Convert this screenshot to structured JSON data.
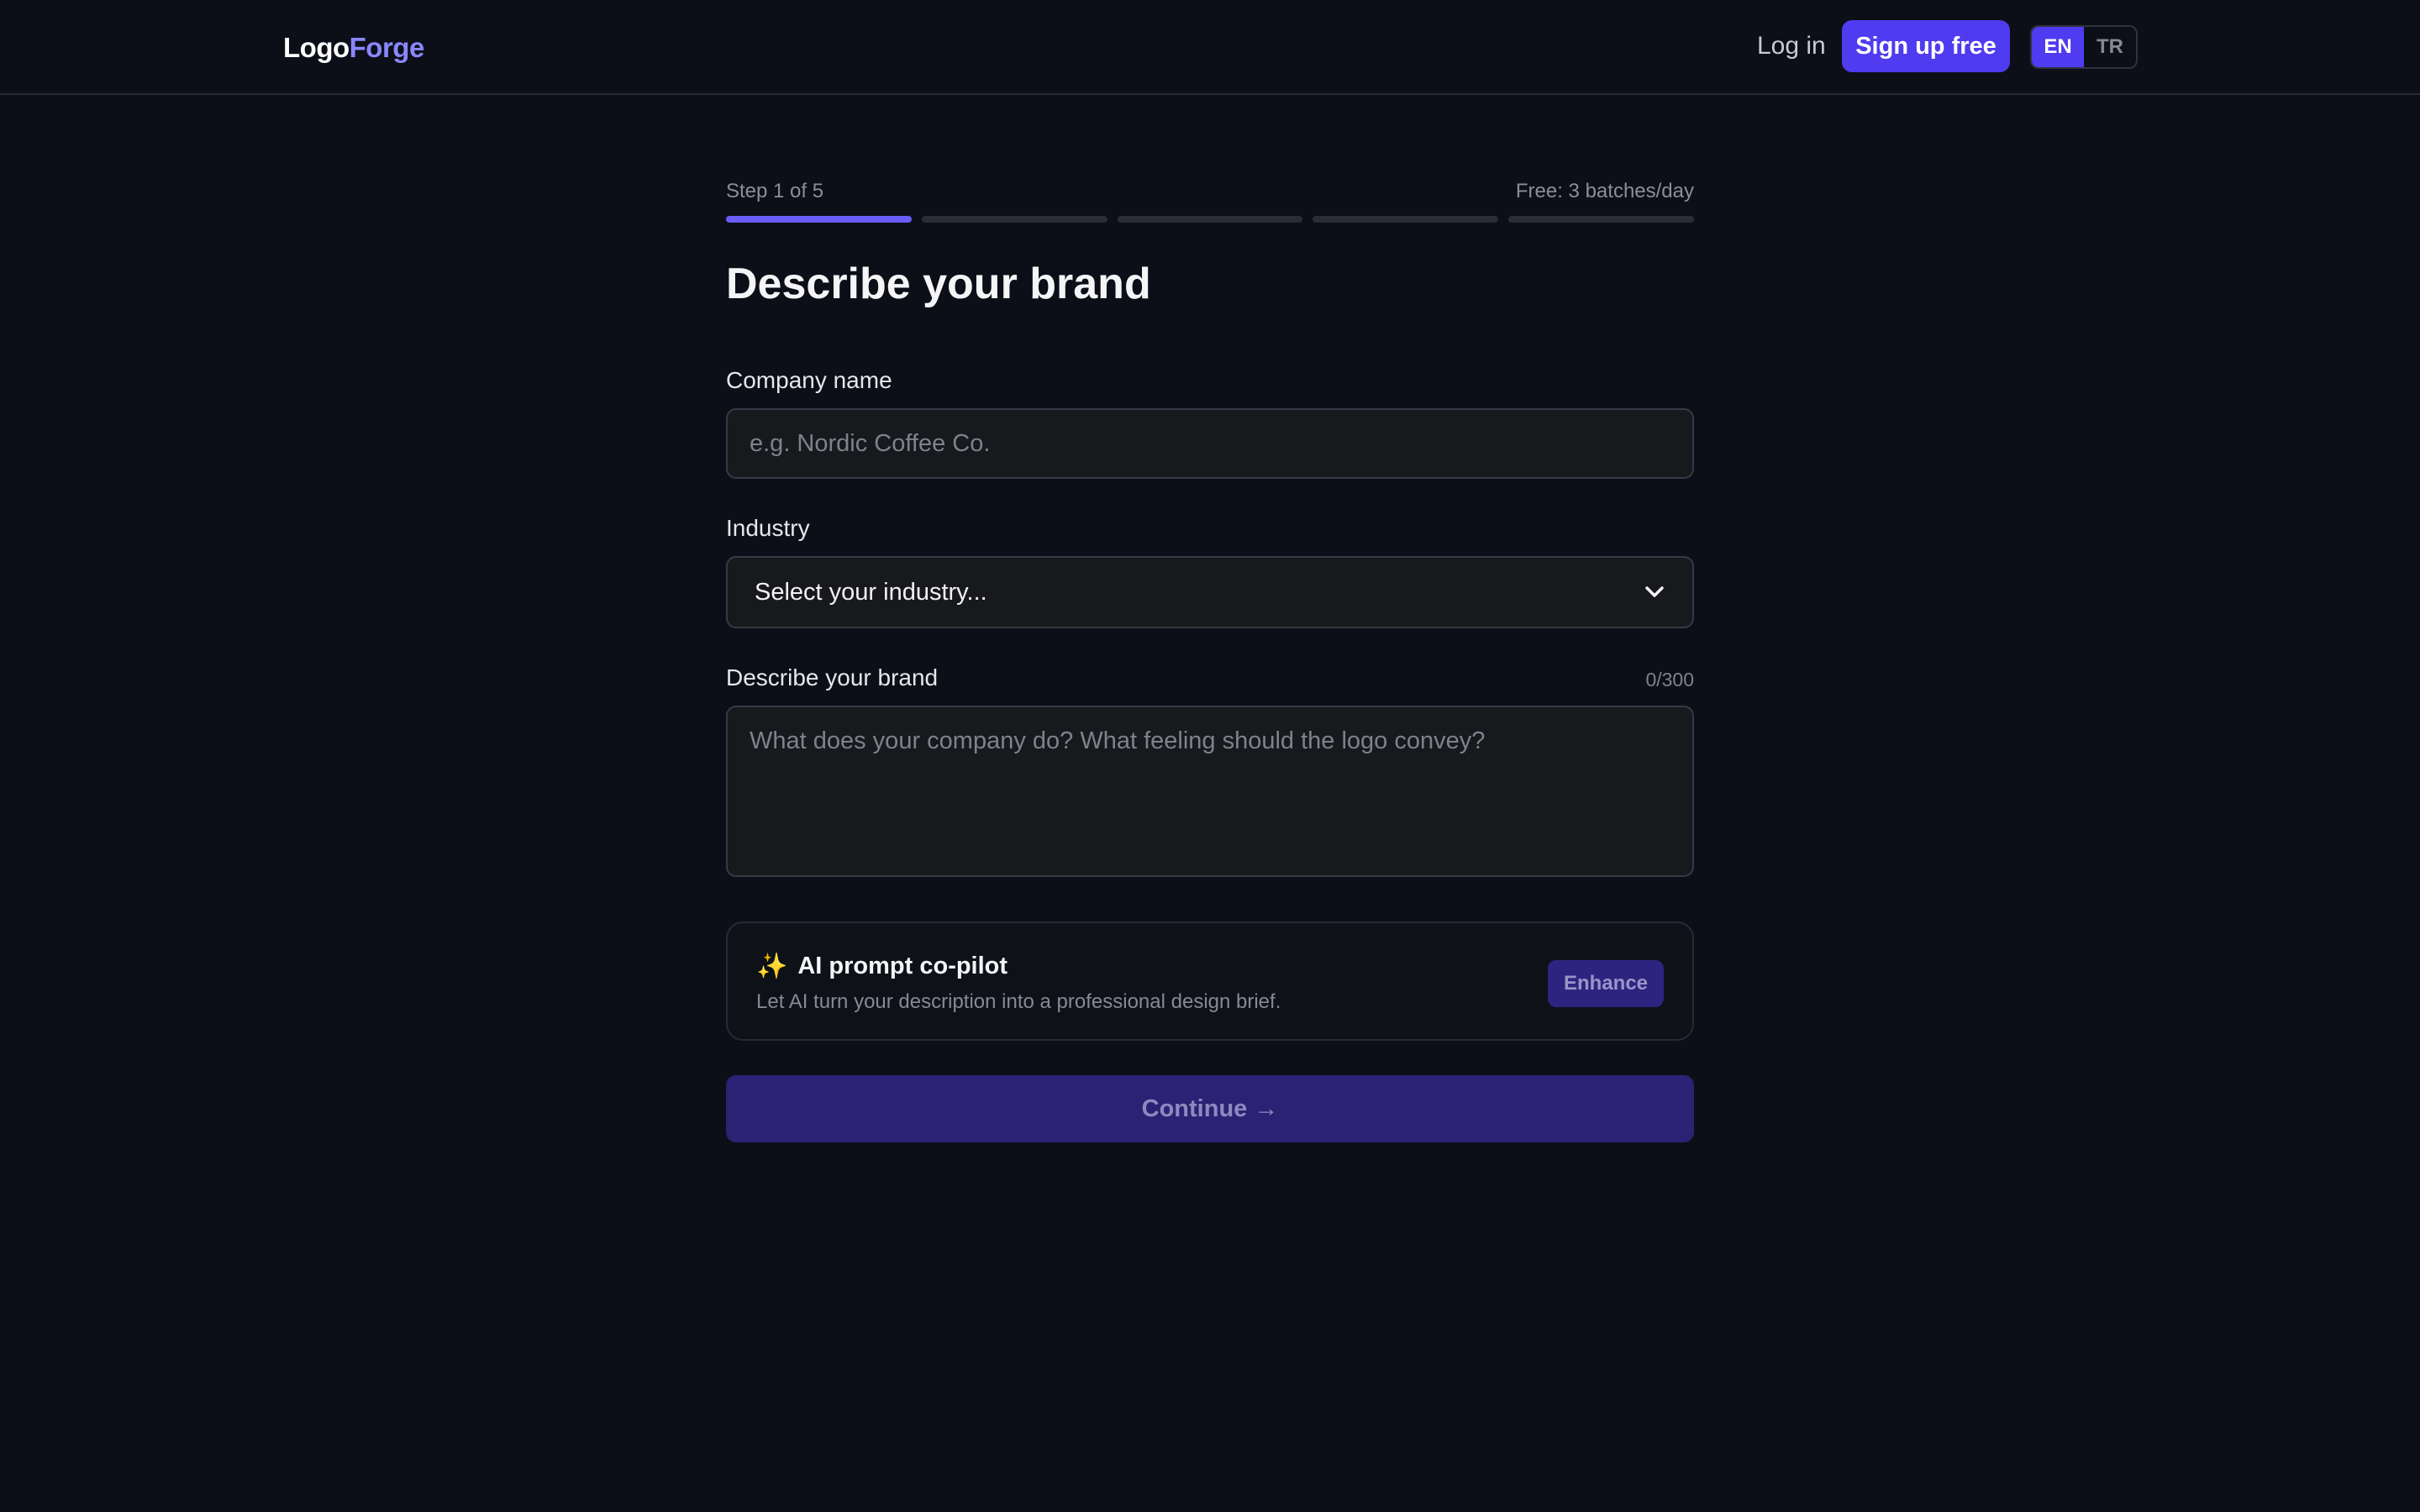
{
  "header": {
    "logo_part1": "Logo",
    "logo_part2": "Forge",
    "login_label": "Log in",
    "signup_label": "Sign up free",
    "languages": [
      {
        "code": "EN",
        "active": true
      },
      {
        "code": "TR",
        "active": false
      }
    ]
  },
  "stepper": {
    "step_label": "Step 1 of 5",
    "free_label": "Free: 3 batches/day",
    "total_steps": 5,
    "current_step": 1
  },
  "form": {
    "title": "Describe your brand",
    "company": {
      "label": "Company name",
      "value": "",
      "placeholder": "e.g. Nordic Coffee Co."
    },
    "industry": {
      "label": "Industry",
      "selected": "Select your industry..."
    },
    "description": {
      "label": "Describe your brand",
      "counter": "0/300",
      "value": "",
      "placeholder": "What does your company do? What feeling should the logo convey?"
    },
    "copilot": {
      "icon": "sparkles-icon",
      "title": "AI prompt co-pilot",
      "subtitle": "Let AI turn your description into a professional design brief.",
      "enhance_label": "Enhance"
    },
    "continue_label": "Continue →"
  },
  "colors": {
    "background": "#0c0f17",
    "accent": "#4f3bf0",
    "accent_disabled": "#2b2275",
    "progress_active": "#6a5cf6",
    "logo_accent": "#8a86ff"
  }
}
